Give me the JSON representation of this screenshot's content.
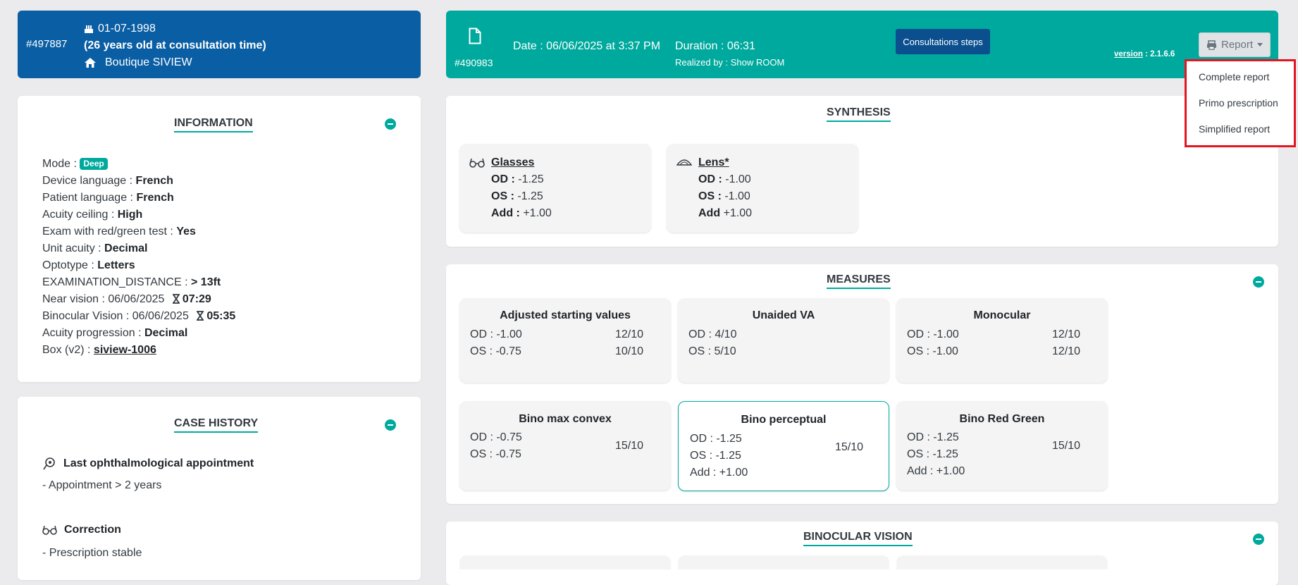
{
  "patient": {
    "id": "#497887",
    "birthdate": "01-07-1998",
    "age_text": "(26 years old at consultation time)",
    "store": "Boutique SIVIEW"
  },
  "consultation": {
    "id": "#490983",
    "date": "Date : 06/06/2025 at 3:37 PM",
    "duration": "Duration : 06:31",
    "realized_by": "Realized by : Show ROOM",
    "steps_button": "Consultations steps",
    "version_label": "version",
    "version_value": ": 2.1.6.6",
    "report_button": "Report"
  },
  "report_menu": [
    "Complete report",
    "Primo prescription",
    "Simplified report"
  ],
  "information": {
    "title": "INFORMATION",
    "mode_label": "Mode :",
    "mode_badge": "Deep",
    "rows": [
      {
        "label": "Device language :",
        "value": "French"
      },
      {
        "label": "Patient language :",
        "value": "French"
      },
      {
        "label": "Acuity ceiling :",
        "value": "High"
      },
      {
        "label": "Exam with red/green test :",
        "value": "Yes"
      },
      {
        "label": "Unit acuity :",
        "value": "Decimal"
      },
      {
        "label": "Optotype :",
        "value": "Letters"
      },
      {
        "label": "EXAMINATION_DISTANCE :",
        "value": "> 13ft"
      }
    ],
    "near_vision": {
      "label": "Near vision : 06/06/2025",
      "time": "07:29"
    },
    "binocular_vision": {
      "label": "Binocular Vision : 06/06/2025",
      "time": "05:35"
    },
    "acuity_progression": {
      "label": "Acuity progression :",
      "value": "Decimal"
    },
    "box": {
      "label": "Box (v2) :",
      "value": "siview-1006"
    }
  },
  "case_history": {
    "title": "CASE HISTORY",
    "items": [
      {
        "heading": "Last ophthalmological appointment",
        "detail": "- Appointment > 2 years"
      },
      {
        "heading": "Correction",
        "detail": "- Prescription stable"
      }
    ]
  },
  "synthesis": {
    "title": "SYNTHESIS",
    "cards": [
      {
        "name": "Glasses",
        "od": "-1.25",
        "os": "-1.25",
        "add_label": "Add :",
        "add": "+1.00"
      },
      {
        "name": "Lens*",
        "od": "-1.00",
        "os": "-1.00",
        "add_label": "Add",
        "add": "+1.00"
      }
    ],
    "od_label": "OD :",
    "os_label": "OS :"
  },
  "measures": {
    "title": "MEASURES",
    "cards": [
      {
        "title": "Adjusted starting values",
        "l1": "OD : -1.00",
        "l2": "OS : -0.75",
        "r1": "12/10",
        "r2": "10/10"
      },
      {
        "title": "Unaided VA",
        "l1": "OD : 4/10",
        "l2": "OS : 5/10"
      },
      {
        "title": "Monocular",
        "l1": "OD : -1.00",
        "l2": "OS : -1.00",
        "r1": "12/10",
        "r2": "12/10"
      },
      {
        "title": "Bino max convex",
        "l1": "OD : -0.75",
        "l2": "OS : -0.75",
        "r1": "15/10"
      },
      {
        "title": "Bino perceptual",
        "l1": "OD : -1.25",
        "l2": "OS : -1.25",
        "l3": "Add : +1.00",
        "r1": "15/10"
      },
      {
        "title": "Bino Red Green",
        "l1": "OD : -1.25",
        "l2": "OS : -1.25",
        "l3": "Add : +1.00",
        "r1": "15/10"
      }
    ]
  },
  "binocular_vision_panel": {
    "title": "BINOCULAR VISION"
  },
  "colors": {
    "navy": "#0a5ea3",
    "teal": "#00a99d",
    "highlight": "#e3151f"
  }
}
